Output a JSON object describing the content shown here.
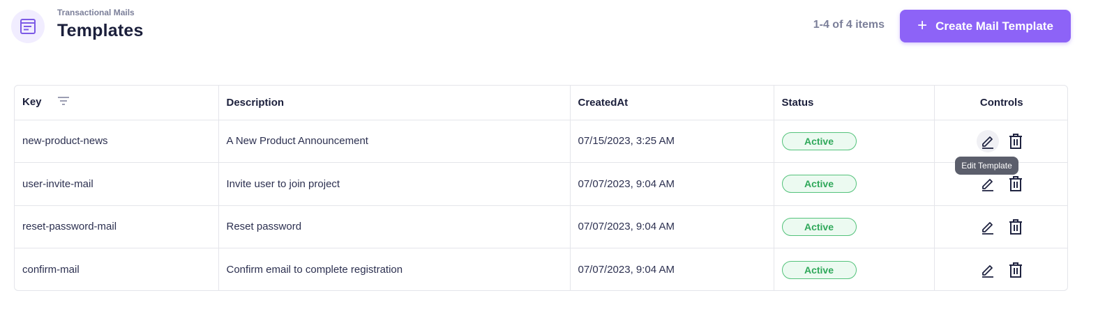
{
  "header": {
    "breadcrumb": "Transactional Mails",
    "title": "Templates",
    "item_count": "1-4 of 4 items",
    "create_button_label": "Create Mail Template",
    "page_icon": "document-icon"
  },
  "table": {
    "columns": [
      "Key",
      "Description",
      "CreatedAt",
      "Status",
      "Controls"
    ],
    "rows": [
      {
        "key": "new-product-news",
        "description": "A New Product Announcement",
        "created_at": "07/15/2023, 3:25 AM",
        "status": "Active"
      },
      {
        "key": "user-invite-mail",
        "description": "Invite user to join project",
        "created_at": "07/07/2023, 9:04 AM",
        "status": "Active"
      },
      {
        "key": "reset-password-mail",
        "description": "Reset password",
        "created_at": "07/07/2023, 9:04 AM",
        "status": "Active"
      },
      {
        "key": "confirm-mail",
        "description": "Confirm email to complete registration",
        "created_at": "07/07/2023, 9:04 AM",
        "status": "Active"
      }
    ]
  },
  "tooltip": {
    "text": "Edit Template"
  },
  "colors": {
    "accent": "#8d63f7",
    "status_active": "#2fa85a"
  }
}
